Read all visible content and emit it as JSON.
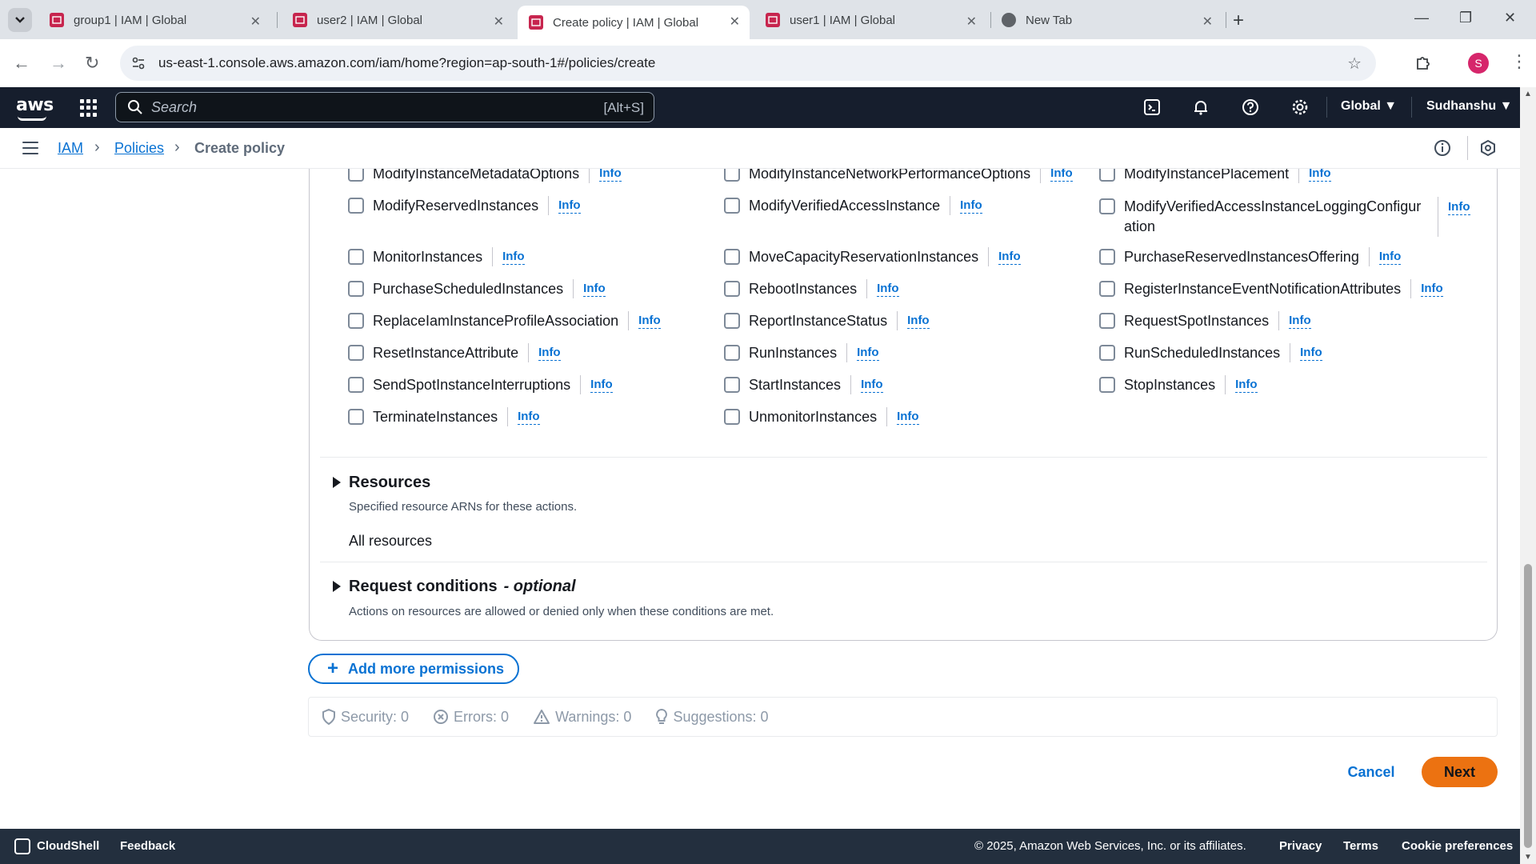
{
  "browser": {
    "tabs": [
      {
        "title": "group1 | IAM | Global",
        "active": false
      },
      {
        "title": "user2 | IAM | Global",
        "active": false
      },
      {
        "title": "Create policy | IAM | Global",
        "active": true
      },
      {
        "title": "user1 | IAM | Global",
        "active": false
      },
      {
        "title": "New Tab",
        "active": false
      }
    ],
    "url": "us-east-1.console.aws.amazon.com/iam/home?region=ap-south-1#/policies/create",
    "profile_initial": "S"
  },
  "aws_header": {
    "logo_text": "aws",
    "search_placeholder": "Search",
    "search_shortcut": "[Alt+S]",
    "region": "Global",
    "user": "Sudhanshu"
  },
  "breadcrumb": {
    "items": [
      "IAM",
      "Policies",
      "Create policy"
    ]
  },
  "actions": {
    "info_label": "Info",
    "rows": [
      [
        "ModifyInstanceMetadataOptions",
        "ModifyInstanceNetworkPerformanceOptions",
        "ModifyInstancePlacement"
      ],
      [
        "ModifyReservedInstances",
        "ModifyVerifiedAccessInstance",
        "ModifyVerifiedAccessInstanceLoggingConfigur",
        "ation"
      ],
      [
        "MonitorInstances",
        "MoveCapacityReservationInstances",
        "PurchaseReservedInstancesOffering"
      ],
      [
        "PurchaseScheduledInstances",
        "RebootInstances",
        "RegisterInstanceEventNotificationAttributes"
      ],
      [
        "ReplaceIamInstanceProfileAssociation",
        "ReportInstanceStatus",
        "RequestSpotInstances"
      ],
      [
        "ResetInstanceAttribute",
        "RunInstances",
        "RunScheduledInstances"
      ],
      [
        "SendSpotInstanceInterruptions",
        "StartInstances",
        "StopInstances"
      ],
      [
        "TerminateInstances",
        "UnmonitorInstances"
      ]
    ]
  },
  "resources": {
    "title": "Resources",
    "description": "Specified resource ARNs for these actions.",
    "value": "All resources"
  },
  "conditions": {
    "title": "Request conditions",
    "optional": "- optional",
    "description": "Actions on resources are allowed or denied only when these conditions are met."
  },
  "add_permissions_label": "Add more permissions",
  "validation": {
    "security": "Security: 0",
    "errors": "Errors: 0",
    "warnings": "Warnings: 0",
    "suggestions": "Suggestions: 0"
  },
  "buttons": {
    "cancel": "Cancel",
    "next": "Next"
  },
  "footer": {
    "cloudshell": "CloudShell",
    "feedback": "Feedback",
    "copyright": "© 2025, Amazon Web Services, Inc. or its affiliates.",
    "privacy": "Privacy",
    "terms": "Terms",
    "cookie": "Cookie preferences"
  },
  "colors": {
    "aws_header_bg": "#161e2d",
    "link_blue": "#0972d3",
    "next_orange": "#ec7211",
    "footer_bg": "#232f3e"
  }
}
